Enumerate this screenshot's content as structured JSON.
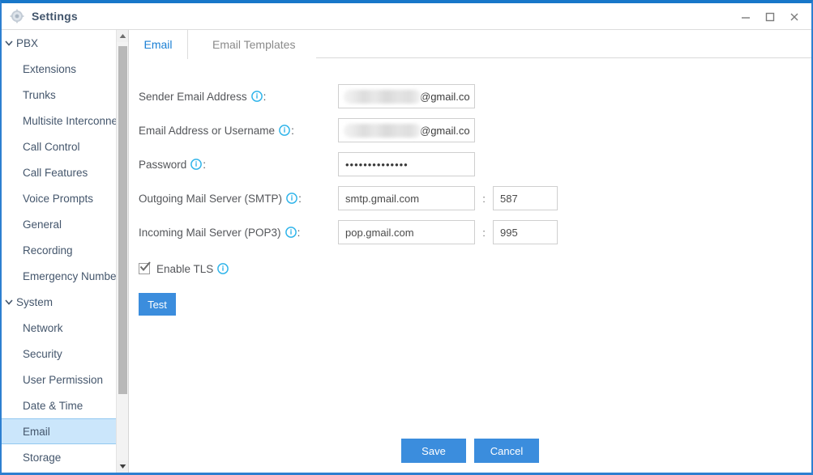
{
  "window": {
    "title": "Settings",
    "icon": "gear-icon",
    "controls": {
      "minimize": "minimize-icon",
      "maximize": "maximize-icon",
      "close": "close-icon"
    },
    "accent_color": "#1877d0",
    "border_color": "#2d7fd0"
  },
  "sidebar": {
    "selected": "Email",
    "selected_bg": "#cbe6fb",
    "items": [
      {
        "label": "PBX",
        "type": "group",
        "expanded": true
      },
      {
        "label": "Extensions",
        "type": "child"
      },
      {
        "label": "Trunks",
        "type": "child"
      },
      {
        "label": "Multisite Interconnect",
        "type": "child"
      },
      {
        "label": "Call Control",
        "type": "child"
      },
      {
        "label": "Call Features",
        "type": "child"
      },
      {
        "label": "Voice Prompts",
        "type": "child"
      },
      {
        "label": "General",
        "type": "child"
      },
      {
        "label": "Recording",
        "type": "child"
      },
      {
        "label": "Emergency Number",
        "type": "child"
      },
      {
        "label": "System",
        "type": "group",
        "expanded": true
      },
      {
        "label": "Network",
        "type": "child"
      },
      {
        "label": "Security",
        "type": "child"
      },
      {
        "label": "User Permission",
        "type": "child"
      },
      {
        "label": "Date & Time",
        "type": "child"
      },
      {
        "label": "Email",
        "type": "child",
        "selected": true
      },
      {
        "label": "Storage",
        "type": "child"
      }
    ],
    "scrollbar": {
      "up_arrow": "triangle-up-icon",
      "down_arrow": "triangle-down-icon"
    }
  },
  "tabs": [
    {
      "label": "Email",
      "active": true
    },
    {
      "label": "Email Templates",
      "active": false
    }
  ],
  "form": {
    "rows": [
      {
        "label": "Sender Email Address",
        "info": true,
        "value": "@gmail.co",
        "masked": true
      },
      {
        "label": "Email Address or Username",
        "info": true,
        "value": "@gmail.co",
        "masked": true
      },
      {
        "label": "Password",
        "info": true,
        "value": "••••••••••••••"
      },
      {
        "label": "Outgoing Mail Server (SMTP)",
        "info": true,
        "value": "smtp.gmail.com",
        "port": "587",
        "separator": ":"
      },
      {
        "label": "Incoming Mail Server (POP3)",
        "info": true,
        "value": "pop.gmail.com",
        "port": "995",
        "separator": ":"
      }
    ],
    "colon": ":",
    "tls": {
      "label": "Enable TLS",
      "checked": true,
      "info": true
    },
    "test_button": "Test"
  },
  "footer": {
    "save_label": "Save",
    "cancel_label": "Cancel",
    "button_color": "#3b8ddd"
  }
}
